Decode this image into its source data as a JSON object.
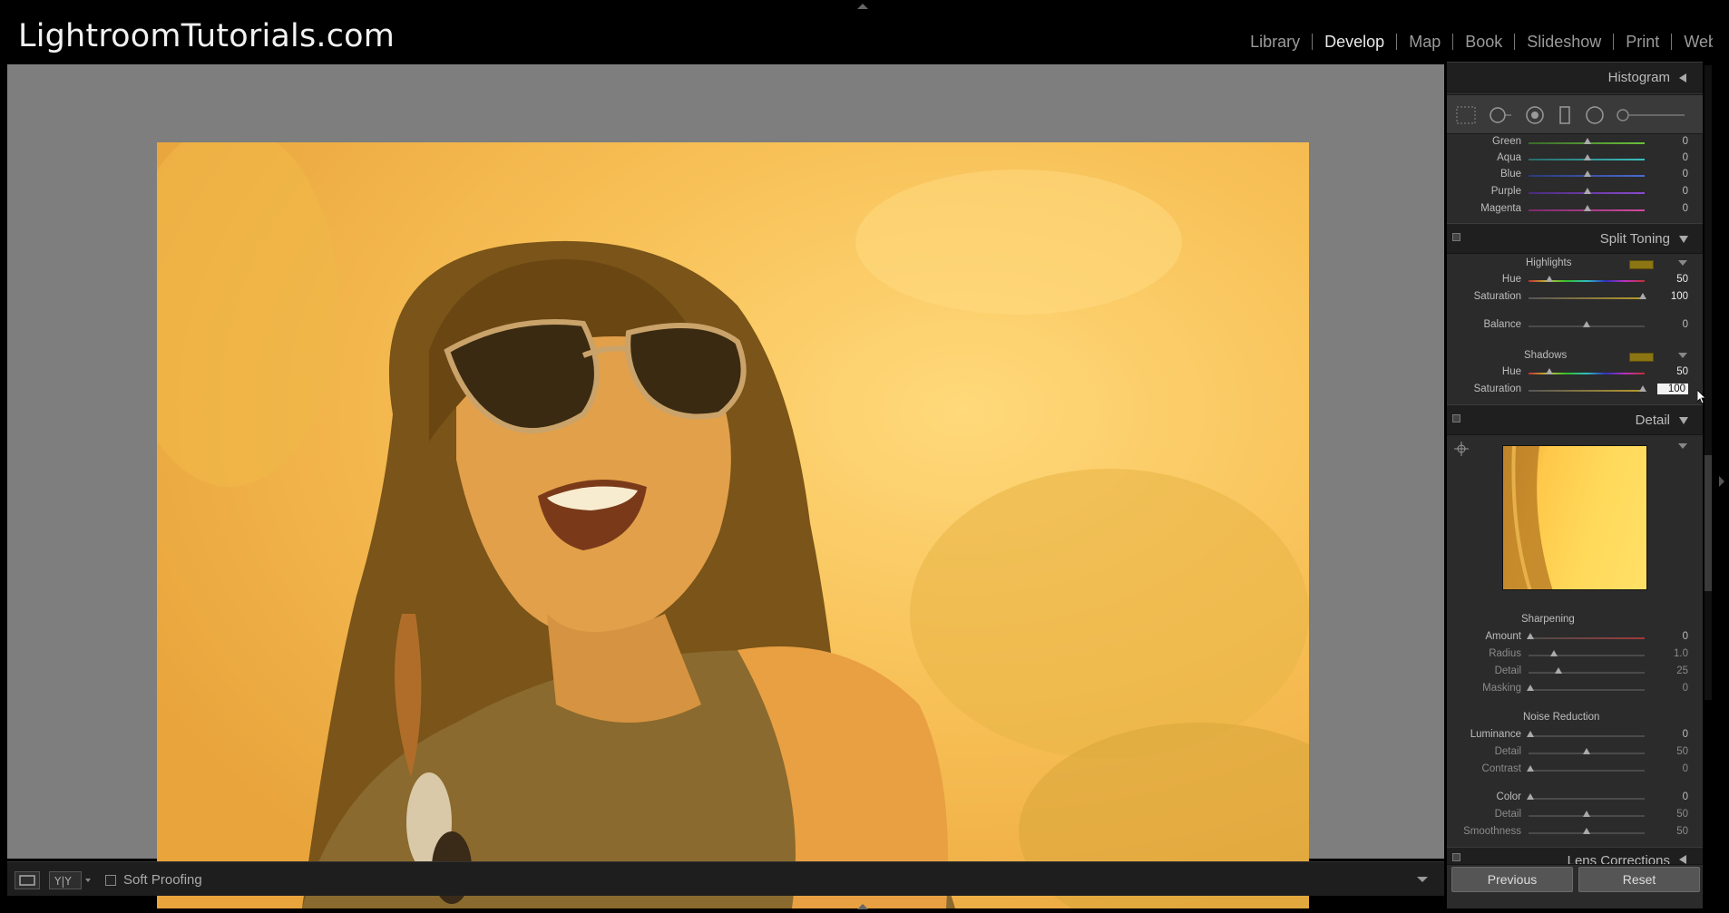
{
  "brand": "LightroomTutorials.com",
  "modules": [
    "Library",
    "Develop",
    "Map",
    "Book",
    "Slideshow",
    "Print",
    "Web"
  ],
  "active_module": "Develop",
  "panels": {
    "histogram_title": "Histogram",
    "hsl_rows": [
      {
        "label": "Green",
        "value": "0"
      },
      {
        "label": "Aqua",
        "value": "0"
      },
      {
        "label": "Blue",
        "value": "0"
      },
      {
        "label": "Purple",
        "value": "0"
      },
      {
        "label": "Magenta",
        "value": "0"
      }
    ],
    "split_toning": {
      "title": "Split Toning",
      "highlights_label": "Highlights",
      "highlights_hue_label": "Hue",
      "highlights_hue": "50",
      "highlights_sat_label": "Saturation",
      "highlights_sat": "100",
      "balance_label": "Balance",
      "balance": "0",
      "shadows_label": "Shadows",
      "shadows_hue_label": "Hue",
      "shadows_hue": "50",
      "shadows_sat_label": "Saturation",
      "shadows_sat": "100",
      "swatch_color": "#8b7613"
    },
    "detail": {
      "title": "Detail",
      "sharpening_label": "Sharpening",
      "sharpening": [
        {
          "label": "Amount",
          "value": "0"
        },
        {
          "label": "Radius",
          "value": "1.0"
        },
        {
          "label": "Detail",
          "value": "25"
        },
        {
          "label": "Masking",
          "value": "0"
        }
      ],
      "noise_label": "Noise Reduction",
      "noise": [
        {
          "label": "Luminance",
          "value": "0"
        },
        {
          "label": "Detail",
          "value": "50"
        },
        {
          "label": "Contrast",
          "value": "0"
        },
        {
          "label": "Color",
          "value": "0"
        },
        {
          "label": "Detail",
          "value": "50"
        },
        {
          "label": "Smoothness",
          "value": "50"
        }
      ]
    },
    "lens_corrections_title": "Lens Corrections"
  },
  "toolbar": {
    "soft_proofing_label": "Soft Proofing",
    "view_icon": "loupe-view-icon",
    "compare_icon": "before-after-icon"
  },
  "buttons": {
    "previous": "Previous",
    "reset": "Reset"
  },
  "colors": {
    "photo_tint": "#f6bb52",
    "panel_bg": "#2b2b2b",
    "stage_bg": "#7e7e7e"
  }
}
